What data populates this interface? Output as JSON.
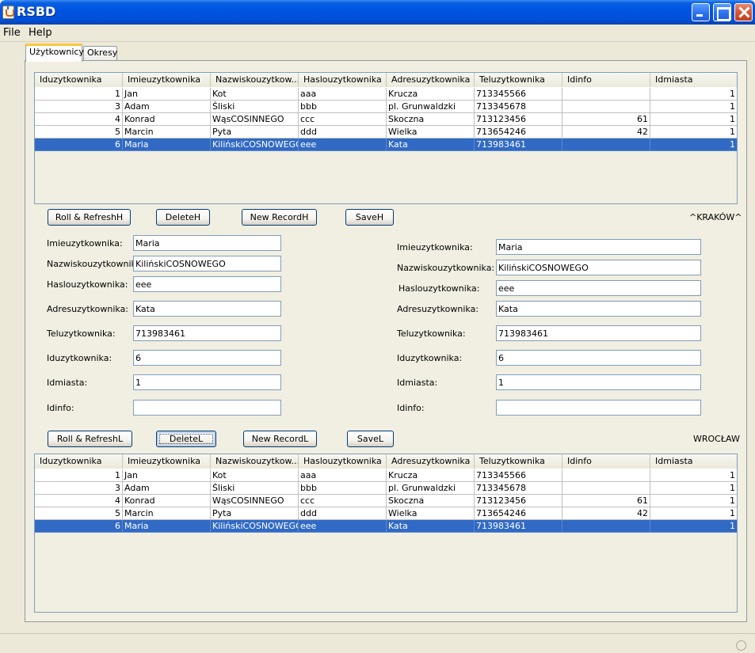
{
  "window": {
    "title": "RSBD"
  },
  "menu": [
    "File",
    "Help"
  ],
  "tabs": [
    "Użytkownicy",
    "Okresy"
  ],
  "columns": [
    "Iduzytkownika",
    "Imieuzytkownika",
    "Nazwiskouzytkow...",
    "Haslouzytkownika",
    "Adresuzytkownika",
    "Teluzytkownika",
    "Idinfo",
    "Idmiasta"
  ],
  "rows": [
    [
      "1",
      "Jan",
      "Kot",
      "aaa",
      "Krucza",
      "713345566",
      "",
      "1"
    ],
    [
      "3",
      "Adam",
      "Śliski",
      "bbb",
      "pl. Grunwaldzki",
      "713345678",
      "",
      "1"
    ],
    [
      "4",
      "Konrad",
      "WąsCOSINNEGO",
      "ccc",
      "Skoczna",
      "713123456",
      "61",
      "1"
    ],
    [
      "5",
      "Marcin",
      "Pyta",
      "ddd",
      "Wielka",
      "713654246",
      "42",
      "1"
    ],
    [
      "6",
      "Maria",
      "KilińskiCOSNOWEGO",
      "eee",
      "Kata",
      "713983461",
      "",
      "1"
    ]
  ],
  "selected_row": 4,
  "buttons_h": [
    "Roll & RefreshH",
    "DeleteH",
    "New RecordH",
    "SaveH"
  ],
  "buttons_l": [
    "Roll & RefreshL",
    "DeleteL",
    "New RecordL",
    "SaveL"
  ],
  "city_h": "^KRAKÓW^",
  "city_l": "WROCŁAW",
  "form_labels": [
    "Imieuzytkownika:",
    "Nazwiskouzytkownika:",
    "Haslouzytkownika:",
    "Adresuzytkownika:",
    "Teluzytkownika:",
    "Iduzytkownika:",
    "Idmiasta:",
    "Idinfo:"
  ],
  "form_left": [
    "Maria",
    "KilińskiCOSNOWEGO",
    "eee",
    "Kata",
    "713983461",
    "6",
    "1",
    ""
  ],
  "form_right": [
    "Maria",
    "KilińskiCOSNOWEGO",
    "eee",
    "Kata",
    "713983461",
    "6",
    "1",
    ""
  ]
}
